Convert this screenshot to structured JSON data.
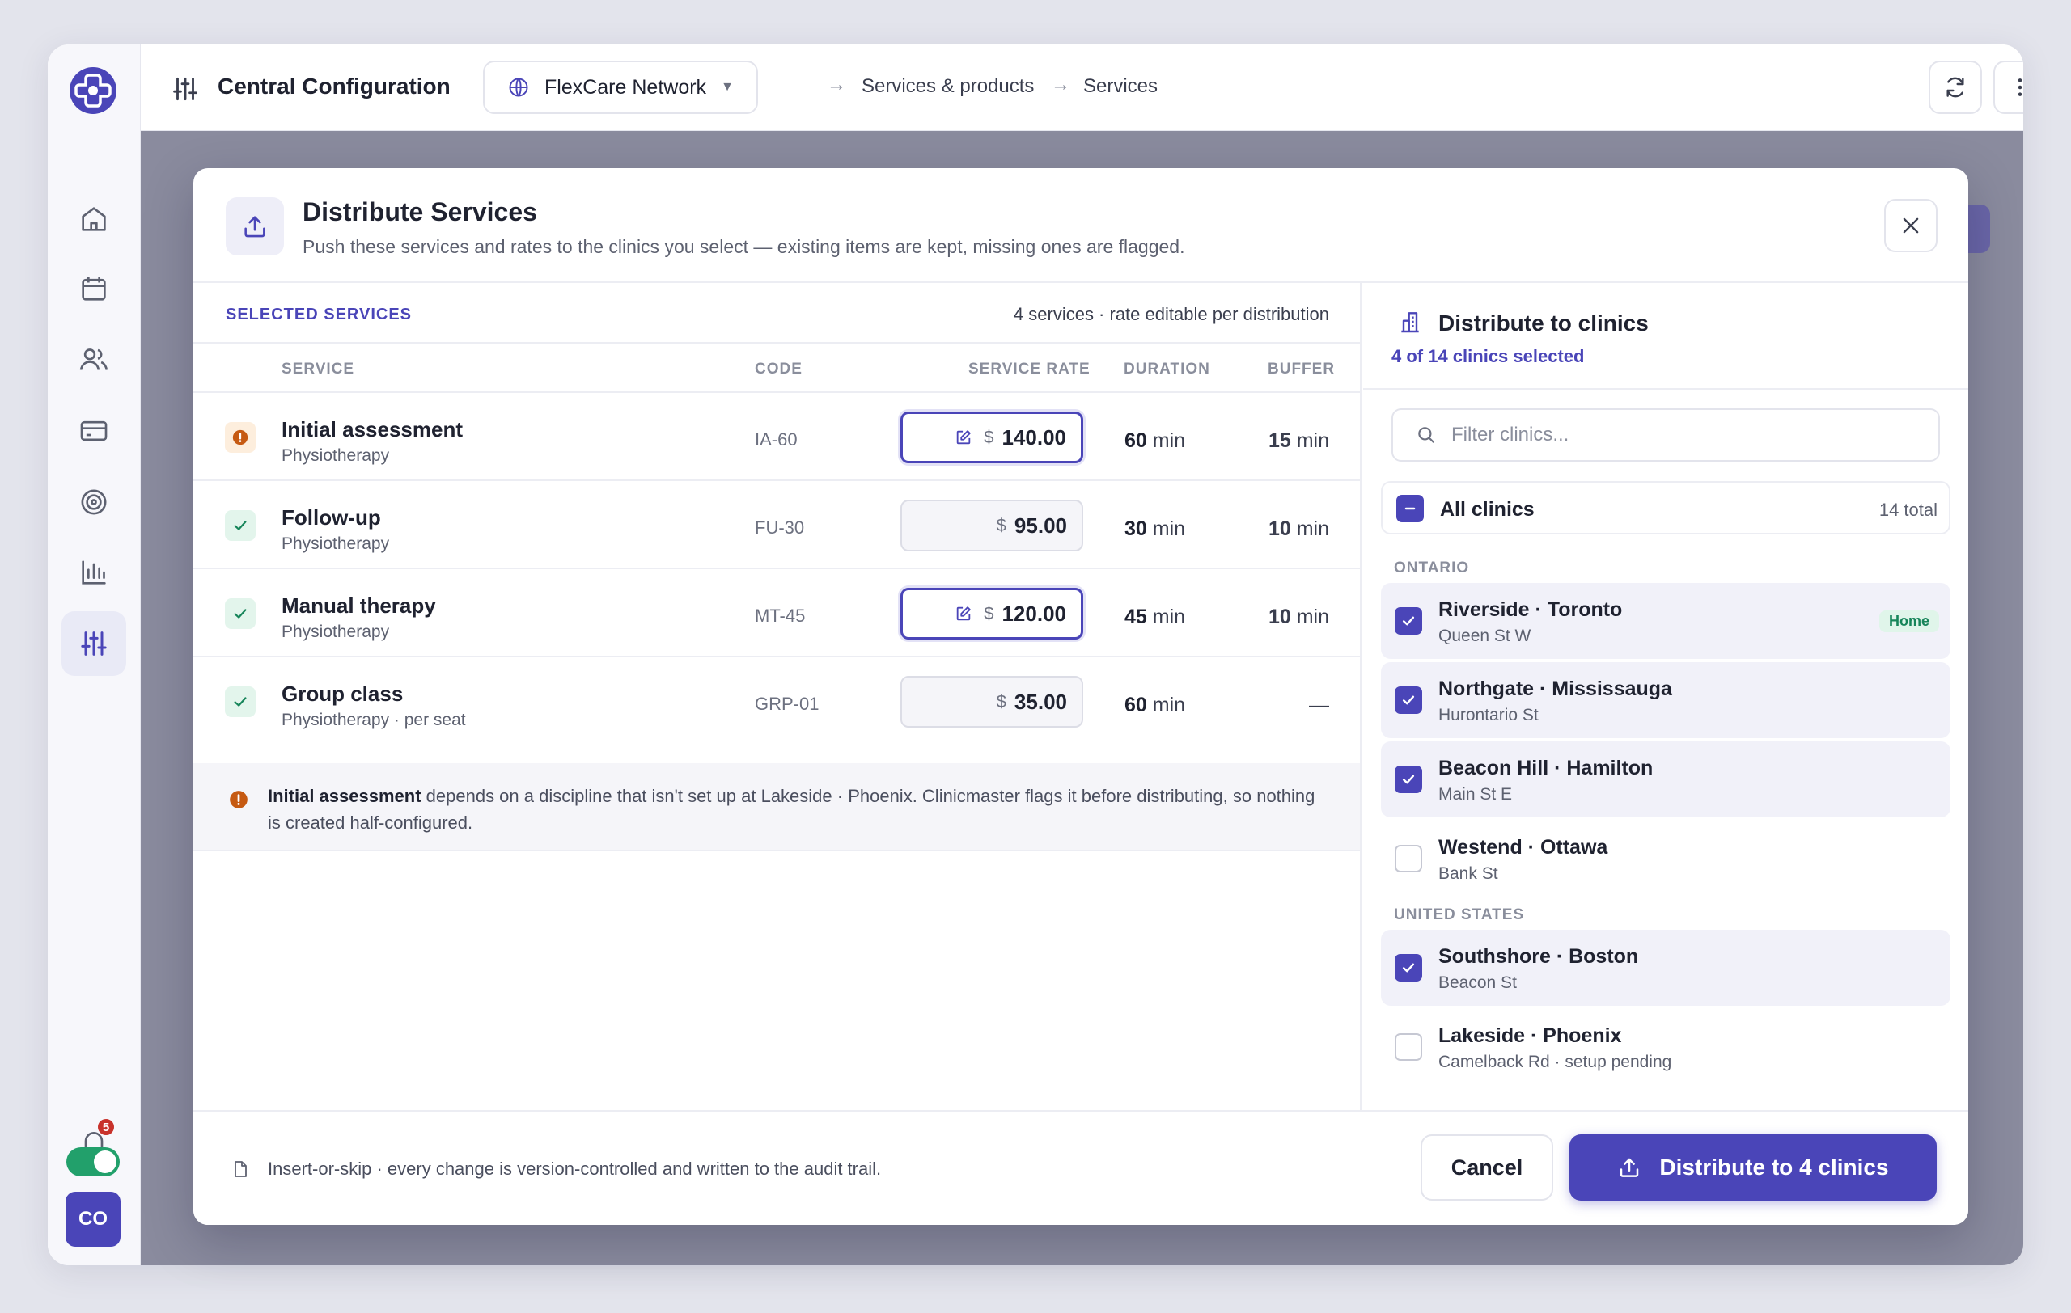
{
  "app": {
    "title": "Central Configuration",
    "network": "FlexCare Network",
    "breadcrumb": [
      "Services & products",
      "Services"
    ],
    "brand_color": "#4a45b8"
  },
  "rail": {
    "items": [
      {
        "icon": "home-icon"
      },
      {
        "icon": "calendar-icon"
      },
      {
        "icon": "users-icon"
      },
      {
        "icon": "credit-card-icon"
      },
      {
        "icon": "target-icon"
      },
      {
        "icon": "bar-chart-icon"
      },
      {
        "icon": "sliders-icon",
        "active": true
      }
    ],
    "notifications": "5",
    "avatar": "CO"
  },
  "modal": {
    "title": "Distribute Services",
    "subtitle": "Push these services and rates to the clinics you select — existing items are kept, missing ones are flagged.",
    "selected_title": "SELECTED SERVICES",
    "selected_meta": "4 services · rate editable per distribution",
    "columns": {
      "service": "SERVICE",
      "code": "CODE",
      "rate": "SERVICE RATE",
      "duration": "DURATION",
      "buffer": "BUFFER"
    },
    "services": [
      {
        "name": "Initial assessment",
        "sub": "Physiotherapy",
        "code": "IA-60",
        "currency": "$",
        "rate": "140.00",
        "duration": "60",
        "buffer": "15",
        "unit": "min",
        "status": "warning",
        "edited": true
      },
      {
        "name": "Follow-up",
        "sub": "Physiotherapy",
        "code": "FU-30",
        "currency": "$",
        "rate": "95.00",
        "duration": "30",
        "buffer": "10",
        "unit": "min",
        "status": "ok",
        "edited": false
      },
      {
        "name": "Manual therapy",
        "sub": "Physiotherapy",
        "code": "MT-45",
        "currency": "$",
        "rate": "120.00",
        "duration": "45",
        "buffer": "10",
        "unit": "min",
        "status": "ok",
        "edited": true
      },
      {
        "name": "Group class",
        "sub": "Physiotherapy · per seat",
        "code": "GRP-01",
        "currency": "$",
        "rate": "35.00",
        "duration": "60",
        "buffer": "—",
        "unit": "min",
        "status": "ok",
        "edited": false
      }
    ],
    "warning": {
      "bold": "Initial assessment",
      "text": " depends on a discipline that isn't set up at Lakeside · Phoenix. Clinicmaster flags it before distributing, so nothing is created half-configured."
    },
    "clinics": {
      "title": "Distribute to clinics",
      "count": "4 of 14 clinics selected",
      "filter_placeholder": "Filter clinics...",
      "all_label": "All clinics",
      "all_total": "14 total",
      "groups": [
        {
          "name": "ONTARIO",
          "items": [
            {
              "name": "Riverside · Toronto",
              "sub": "Queen St W",
              "checked": true,
              "badge": "Home"
            },
            {
              "name": "Northgate · Mississauga",
              "sub": "Hurontario St",
              "checked": true
            },
            {
              "name": "Beacon Hill · Hamilton",
              "sub": "Main St E",
              "checked": true
            },
            {
              "name": "Westend · Ottawa",
              "sub": "Bank St",
              "checked": false
            }
          ]
        },
        {
          "name": "UNITED STATES",
          "items": [
            {
              "name": "Southshore · Boston",
              "sub": "Beacon St",
              "checked": true
            },
            {
              "name": "Lakeside · Phoenix",
              "sub": "Camelback Rd · setup pending",
              "checked": false
            }
          ]
        }
      ]
    },
    "footer": {
      "note": "Insert-or-skip · every change is version-controlled and written to the audit trail.",
      "cancel": "Cancel",
      "primary": "Distribute to 4 clinics"
    }
  }
}
